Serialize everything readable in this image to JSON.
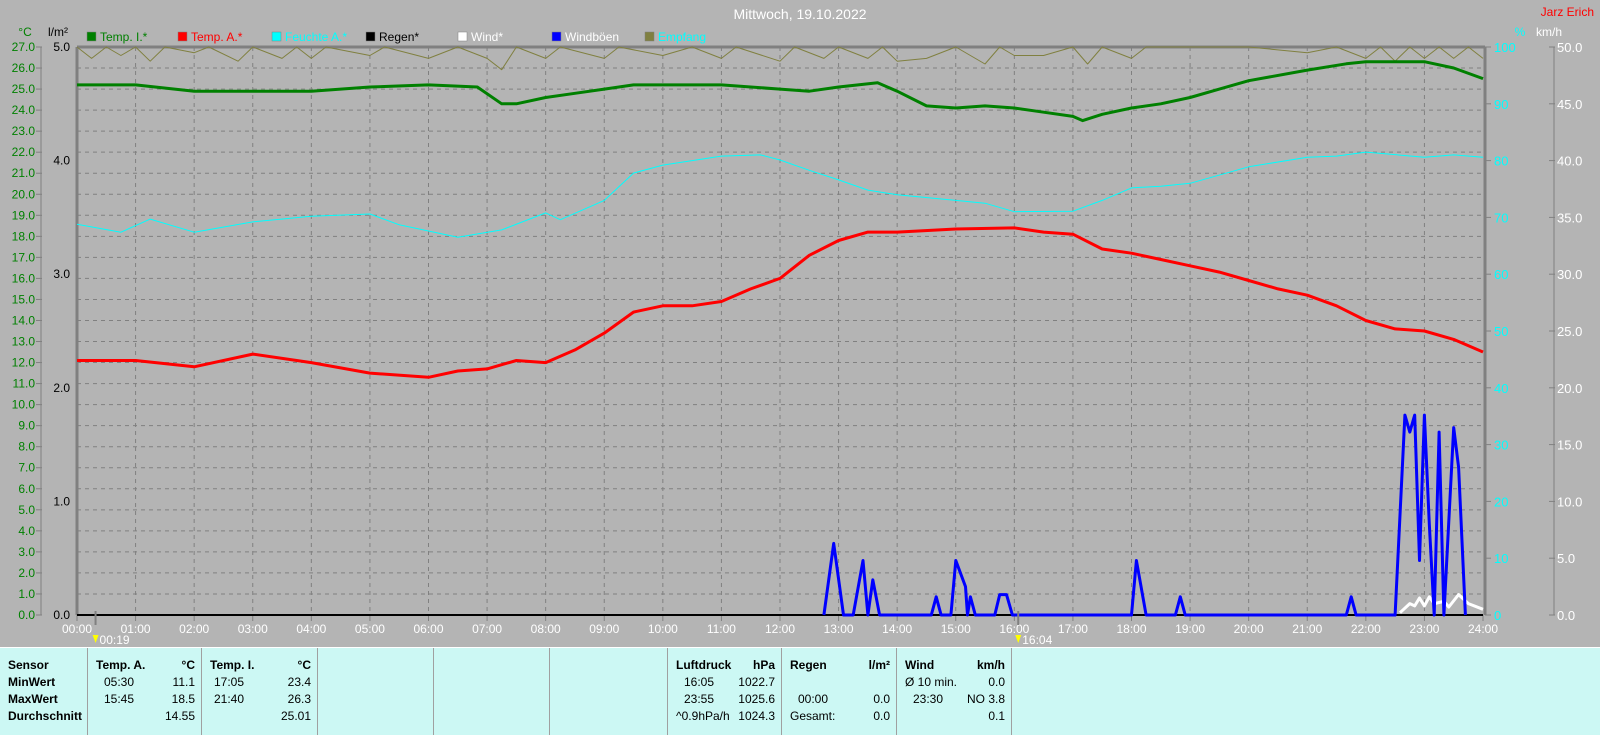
{
  "header": {
    "title": "Mittwoch, 19.10.2022",
    "owner": "Jarz Erich"
  },
  "colors": {
    "temp_i": "#008000",
    "temp_a": "#ff0000",
    "feuchte": "#00ffff",
    "regen": "#000000",
    "wind": "#ffffff",
    "windboeen": "#0000ff",
    "empfang": "#808040",
    "background": "#b4b4b4",
    "panel": "#ccf8f4"
  },
  "chart_data": {
    "type": "line",
    "title": "Mittwoch, 19.10.2022",
    "grid": true,
    "legend_placement": "top",
    "x_ticks": [
      "00:00",
      "01:00",
      "02:00",
      "03:00",
      "04:00",
      "05:00",
      "06:00",
      "07:00",
      "08:00",
      "09:00",
      "10:00",
      "11:00",
      "12:00",
      "13:00",
      "14:00",
      "15:00",
      "16:00",
      "17:00",
      "18:00",
      "19:00",
      "20:00",
      "21:00",
      "22:00",
      "23:00",
      "24:00"
    ],
    "x_markers": [
      {
        "time": "00:19",
        "label": "00:19"
      },
      {
        "time": "16:04",
        "label": "16:04"
      }
    ],
    "axes": {
      "temp": {
        "unit": "°C",
        "range": [
          0,
          27
        ],
        "ticks": [
          "0.0",
          "1.0",
          "2.0",
          "3.0",
          "4.0",
          "5.0",
          "6.0",
          "7.0",
          "8.0",
          "9.0",
          "10.0",
          "11.0",
          "12.0",
          "13.0",
          "14.0",
          "15.0",
          "16.0",
          "17.0",
          "18.0",
          "19.0",
          "20.0",
          "21.0",
          "22.0",
          "23.0",
          "24.0",
          "25.0",
          "26.0",
          "27.0"
        ]
      },
      "rain": {
        "unit": "l/m²",
        "range": [
          0,
          5
        ],
        "ticks": [
          "0.0",
          "1.0",
          "2.0",
          "3.0",
          "4.0",
          "5.0"
        ]
      },
      "humidity": {
        "unit": "%",
        "range": [
          0,
          100
        ],
        "ticks": [
          "0",
          "10",
          "20",
          "30",
          "40",
          "50",
          "60",
          "70",
          "80",
          "90",
          "100"
        ]
      },
      "wind": {
        "unit": "km/h",
        "range": [
          0,
          50
        ],
        "ticks": [
          "0.0",
          "5.0",
          "10.0",
          "15.0",
          "20.0",
          "25.0",
          "30.0",
          "35.0",
          "40.0",
          "45.0",
          "50.0"
        ]
      }
    },
    "series": [
      {
        "name": "Temp. I.*",
        "axis": "temp",
        "color": "#008000",
        "points": [
          [
            "00:00",
            25.2
          ],
          [
            "01:00",
            25.2
          ],
          [
            "02:00",
            24.9
          ],
          [
            "03:00",
            24.9
          ],
          [
            "04:00",
            24.9
          ],
          [
            "05:00",
            25.1
          ],
          [
            "06:00",
            25.2
          ],
          [
            "06:50",
            25.1
          ],
          [
            "07:15",
            24.3
          ],
          [
            "07:30",
            24.3
          ],
          [
            "08:00",
            24.6
          ],
          [
            "08:30",
            24.8
          ],
          [
            "09:00",
            25.0
          ],
          [
            "09:30",
            25.2
          ],
          [
            "11:00",
            25.2
          ],
          [
            "12:00",
            25.0
          ],
          [
            "12:30",
            24.9
          ],
          [
            "13:00",
            25.1
          ],
          [
            "13:40",
            25.3
          ],
          [
            "14:00",
            24.9
          ],
          [
            "14:30",
            24.2
          ],
          [
            "15:00",
            24.1
          ],
          [
            "15:30",
            24.2
          ],
          [
            "16:00",
            24.1
          ],
          [
            "16:30",
            23.9
          ],
          [
            "17:00",
            23.7
          ],
          [
            "17:10",
            23.5
          ],
          [
            "17:30",
            23.8
          ],
          [
            "18:00",
            24.1
          ],
          [
            "18:30",
            24.3
          ],
          [
            "19:00",
            24.6
          ],
          [
            "19:30",
            25.0
          ],
          [
            "20:00",
            25.4
          ],
          [
            "21:00",
            25.9
          ],
          [
            "21:40",
            26.2
          ],
          [
            "22:00",
            26.3
          ],
          [
            "23:00",
            26.3
          ],
          [
            "23:30",
            26.0
          ],
          [
            "24:00",
            25.5
          ]
        ]
      },
      {
        "name": "Temp. A.*",
        "axis": "temp",
        "color": "#ff0000",
        "points": [
          [
            "00:00",
            12.1
          ],
          [
            "01:00",
            12.1
          ],
          [
            "02:00",
            11.8
          ],
          [
            "03:00",
            12.4
          ],
          [
            "04:00",
            12.0
          ],
          [
            "05:00",
            11.5
          ],
          [
            "06:00",
            11.3
          ],
          [
            "06:30",
            11.6
          ],
          [
            "07:00",
            11.7
          ],
          [
            "07:30",
            12.1
          ],
          [
            "08:00",
            12.0
          ],
          [
            "08:30",
            12.6
          ],
          [
            "09:00",
            13.4
          ],
          [
            "09:30",
            14.4
          ],
          [
            "10:00",
            14.7
          ],
          [
            "10:30",
            14.7
          ],
          [
            "11:00",
            14.9
          ],
          [
            "11:30",
            15.5
          ],
          [
            "12:00",
            16.0
          ],
          [
            "12:30",
            17.1
          ],
          [
            "13:00",
            17.8
          ],
          [
            "13:30",
            18.2
          ],
          [
            "14:00",
            18.2
          ],
          [
            "15:00",
            18.35
          ],
          [
            "16:00",
            18.4
          ],
          [
            "16:30",
            18.2
          ],
          [
            "17:00",
            18.1
          ],
          [
            "17:30",
            17.4
          ],
          [
            "18:00",
            17.2
          ],
          [
            "18:30",
            16.9
          ],
          [
            "19:00",
            16.6
          ],
          [
            "19:30",
            16.3
          ],
          [
            "20:00",
            15.9
          ],
          [
            "20:30",
            15.5
          ],
          [
            "21:00",
            15.2
          ],
          [
            "21:30",
            14.7
          ],
          [
            "22:00",
            14.0
          ],
          [
            "22:30",
            13.6
          ],
          [
            "23:00",
            13.5
          ],
          [
            "23:30",
            13.1
          ],
          [
            "24:00",
            12.5
          ]
        ]
      },
      {
        "name": "Feuchte A.*",
        "axis": "humidity",
        "color": "#00ffff",
        "points": [
          [
            "00:00",
            68.8
          ],
          [
            "00:45",
            67.4
          ],
          [
            "01:15",
            69.7
          ],
          [
            "02:00",
            67.4
          ],
          [
            "03:00",
            69.2
          ],
          [
            "04:00",
            70.2
          ],
          [
            "05:00",
            70.6
          ],
          [
            "05:30",
            68.7
          ],
          [
            "06:30",
            66.5
          ],
          [
            "07:15",
            67.8
          ],
          [
            "08:00",
            70.8
          ],
          [
            "08:15",
            69.6
          ],
          [
            "09:00",
            73.0
          ],
          [
            "09:30",
            77.8
          ],
          [
            "10:00",
            79.2
          ],
          [
            "11:00",
            80.8
          ],
          [
            "11:40",
            81.0
          ],
          [
            "12:00",
            80.1
          ],
          [
            "12:30",
            78.3
          ],
          [
            "13:00",
            76.6
          ],
          [
            "13:30",
            74.8
          ],
          [
            "14:00",
            74.0
          ],
          [
            "15:00",
            73.0
          ],
          [
            "15:30",
            72.5
          ],
          [
            "16:00",
            71.0
          ],
          [
            "17:00",
            71.1
          ],
          [
            "17:30",
            73.0
          ],
          [
            "18:00",
            75.2
          ],
          [
            "18:30",
            75.5
          ],
          [
            "19:00",
            76.0
          ],
          [
            "20:00",
            78.9
          ],
          [
            "21:00",
            80.6
          ],
          [
            "21:30",
            80.8
          ],
          [
            "22:00",
            81.5
          ],
          [
            "23:00",
            80.6
          ],
          [
            "23:30",
            81.0
          ],
          [
            "24:00",
            80.6
          ]
        ]
      },
      {
        "name": "Regen*",
        "axis": "rain",
        "color": "#000000",
        "points": [
          [
            "00:00",
            0
          ],
          [
            "24:00",
            0
          ]
        ]
      },
      {
        "name": "Wind*",
        "axis": "wind",
        "color": "#ffffff",
        "points": [
          [
            "22:35",
            0.2
          ],
          [
            "22:45",
            1.0
          ],
          [
            "22:50",
            0.8
          ],
          [
            "22:55",
            1.5
          ],
          [
            "23:00",
            0.8
          ],
          [
            "23:05",
            1.6
          ],
          [
            "23:10",
            1.0
          ],
          [
            "23:20",
            1.2
          ],
          [
            "23:25",
            0.7
          ],
          [
            "23:35",
            1.8
          ],
          [
            "23:45",
            1.0
          ],
          [
            "24:00",
            0.5
          ]
        ]
      },
      {
        "name": "Windböen",
        "axis": "wind",
        "color": "#0000ff",
        "points": [
          [
            "12:45",
            0
          ],
          [
            "12:55",
            6.3
          ],
          [
            "13:05",
            0
          ],
          [
            "13:15",
            0
          ],
          [
            "13:25",
            4.8
          ],
          [
            "13:30",
            0
          ],
          [
            "13:35",
            3.1
          ],
          [
            "13:42",
            0
          ],
          [
            "14:35",
            0
          ],
          [
            "14:40",
            1.6
          ],
          [
            "14:45",
            0
          ],
          [
            "14:55",
            0
          ],
          [
            "15:00",
            4.8
          ],
          [
            "15:10",
            2.5
          ],
          [
            "15:12",
            0
          ],
          [
            "15:15",
            1.6
          ],
          [
            "15:20",
            0
          ],
          [
            "15:40",
            0
          ],
          [
            "15:45",
            1.8
          ],
          [
            "15:52",
            1.8
          ],
          [
            "15:58",
            0
          ],
          [
            "18:00",
            0
          ],
          [
            "18:05",
            4.8
          ],
          [
            "18:15",
            0
          ],
          [
            "18:45",
            0
          ],
          [
            "18:50",
            1.6
          ],
          [
            "18:55",
            0
          ],
          [
            "21:40",
            0
          ],
          [
            "21:45",
            1.6
          ],
          [
            "21:50",
            0
          ],
          [
            "22:30",
            0
          ],
          [
            "22:40",
            17.6
          ],
          [
            "22:45",
            16.1
          ],
          [
            "22:50",
            17.6
          ],
          [
            "22:55",
            4.8
          ],
          [
            "23:00",
            17.6
          ],
          [
            "23:05",
            8.0
          ],
          [
            "23:10",
            0
          ],
          [
            "23:15",
            16.1
          ],
          [
            "23:20",
            0
          ],
          [
            "23:30",
            16.5
          ],
          [
            "23:35",
            13.0
          ],
          [
            "23:42",
            0
          ]
        ]
      },
      {
        "name": "Empfang",
        "axis": "humidity",
        "color": "#808040",
        "points": [
          [
            "00:00",
            100
          ],
          [
            "00:15",
            98
          ],
          [
            "00:30",
            100
          ],
          [
            "00:45",
            98.5
          ],
          [
            "01:00",
            100
          ],
          [
            "01:15",
            97.5
          ],
          [
            "01:30",
            100
          ],
          [
            "02:00",
            99
          ],
          [
            "02:15",
            100
          ],
          [
            "02:45",
            97.5
          ],
          [
            "03:00",
            100
          ],
          [
            "03:30",
            98
          ],
          [
            "03:45",
            100
          ],
          [
            "04:00",
            98
          ],
          [
            "04:15",
            100
          ],
          [
            "05:00",
            98.5
          ],
          [
            "05:15",
            100
          ],
          [
            "06:00",
            98
          ],
          [
            "06:30",
            100
          ],
          [
            "07:00",
            98
          ],
          [
            "07:15",
            96
          ],
          [
            "07:30",
            100
          ],
          [
            "08:00",
            98
          ],
          [
            "08:15",
            100
          ],
          [
            "09:00",
            98
          ],
          [
            "09:15",
            100
          ],
          [
            "10:00",
            98.5
          ],
          [
            "10:30",
            100
          ],
          [
            "11:00",
            98
          ],
          [
            "11:15",
            100
          ],
          [
            "12:00",
            97.5
          ],
          [
            "12:15",
            100
          ],
          [
            "12:45",
            98
          ],
          [
            "13:00",
            100
          ],
          [
            "13:30",
            98
          ],
          [
            "13:45",
            100
          ],
          [
            "14:00",
            97.5
          ],
          [
            "14:30",
            98
          ],
          [
            "15:00",
            100
          ],
          [
            "15:30",
            97
          ],
          [
            "15:45",
            100
          ],
          [
            "16:00",
            98.5
          ],
          [
            "16:30",
            98.5
          ],
          [
            "17:00",
            100
          ],
          [
            "17:15",
            97
          ],
          [
            "17:30",
            100
          ],
          [
            "18:00",
            98
          ],
          [
            "18:15",
            100
          ],
          [
            "19:00",
            100
          ],
          [
            "20:00",
            100
          ],
          [
            "21:00",
            99
          ],
          [
            "21:30",
            100
          ],
          [
            "22:00",
            98
          ],
          [
            "22:15",
            100
          ],
          [
            "22:30",
            97.5
          ],
          [
            "22:45",
            100
          ],
          [
            "23:00",
            98
          ],
          [
            "23:15",
            100
          ],
          [
            "23:30",
            98
          ],
          [
            "23:45",
            100
          ],
          [
            "24:00",
            98
          ]
        ]
      }
    ]
  },
  "stats": {
    "sensor": {
      "title": "Sensor",
      "rows": [
        "MinWert",
        "MaxWert",
        "Durchschnitt"
      ]
    },
    "temp_a": {
      "title": "Temp. A.",
      "unit": "°C",
      "min_time": "05:30",
      "min": "11.1",
      "max_time": "15:45",
      "max": "18.5",
      "avg": "14.55"
    },
    "temp_i": {
      "title": "Temp. I.",
      "unit": "°C",
      "min_time": "17:05",
      "min": "23.4",
      "max_time": "21:40",
      "max": "26.3",
      "avg": "25.01"
    },
    "luftdruck": {
      "title": "Luftdruck",
      "unit": "hPa",
      "min_time": "16:05",
      "min": "1022.7",
      "max_time": "23:55",
      "max": "1025.6",
      "trend": "^0.9hPa/h",
      "current": "1024.3"
    },
    "regen": {
      "title": "Regen",
      "unit": "l/m²",
      "time": "00:00",
      "value": "0.0",
      "total_label": "Gesamt:",
      "total": "0.0"
    },
    "wind": {
      "title": "Wind",
      "unit": "km/h",
      "avg_label": "Ø 10 min.",
      "avg": "0.0",
      "max_time": "23:30",
      "max": "NO 3.8",
      "mean": "0.1"
    }
  }
}
